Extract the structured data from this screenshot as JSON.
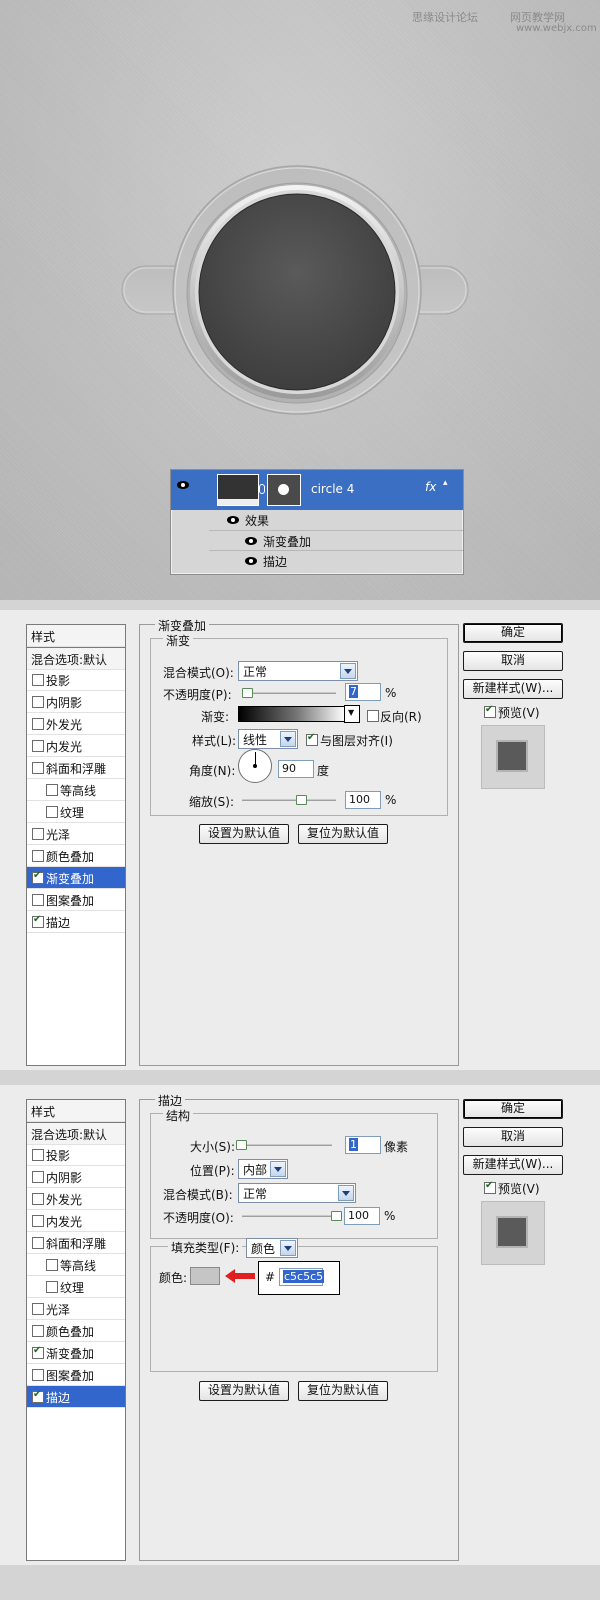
{
  "watermark": {
    "site1": "思缘设计论坛",
    "site2": "网页教学网",
    "url": "www.webjx.com"
  },
  "layers_panel": {
    "layer_name": "circle 4",
    "fx": "fx",
    "effects_label": "效果",
    "effect_items": [
      "渐变叠加",
      "描边"
    ]
  },
  "style_list": {
    "header": "样式",
    "blend_default": "混合选项:默认",
    "items": [
      "投影",
      "内阴影",
      "外发光",
      "内发光",
      "斜面和浮雕",
      "等高线",
      "纹理",
      "光泽",
      "颜色叠加",
      "渐变叠加",
      "图案叠加",
      "描边"
    ]
  },
  "buttons": {
    "ok": "确定",
    "cancel": "取消",
    "new_style": "新建样式(W)...",
    "preview": "预览(V)",
    "set_default": "设置为默认值",
    "reset_default": "复位为默认值"
  },
  "gradient_dialog": {
    "title": "渐变叠加",
    "group": "渐变",
    "blend_mode_label": "混合模式(O):",
    "blend_mode": "正常",
    "opacity_label": "不透明度(P):",
    "opacity": "7",
    "pct": "%",
    "gradient_label": "渐变:",
    "reverse": "反向(R)",
    "style_label": "样式(L):",
    "style": "线性",
    "align": "与图层对齐(I)",
    "angle_label": "角度(N):",
    "angle": "90",
    "deg": "度",
    "scale_label": "缩放(S):",
    "scale": "100"
  },
  "stroke_dialog": {
    "title": "描边",
    "group": "结构",
    "size_label": "大小(S):",
    "size": "1",
    "px": "像素",
    "position_label": "位置(P):",
    "position": "内部",
    "blend_mode_label": "混合模式(B):",
    "blend_mode": "正常",
    "opacity_label": "不透明度(O):",
    "opacity": "100",
    "pct": "%",
    "fill_type_label": "填充类型(F):",
    "fill_type": "颜色",
    "color_label": "颜色:",
    "hash": "#",
    "hex": "c5c5c5"
  },
  "colors": {
    "swatch": "#c5c5c5",
    "selection": "#3366cc",
    "arrow": "#e02020"
  }
}
